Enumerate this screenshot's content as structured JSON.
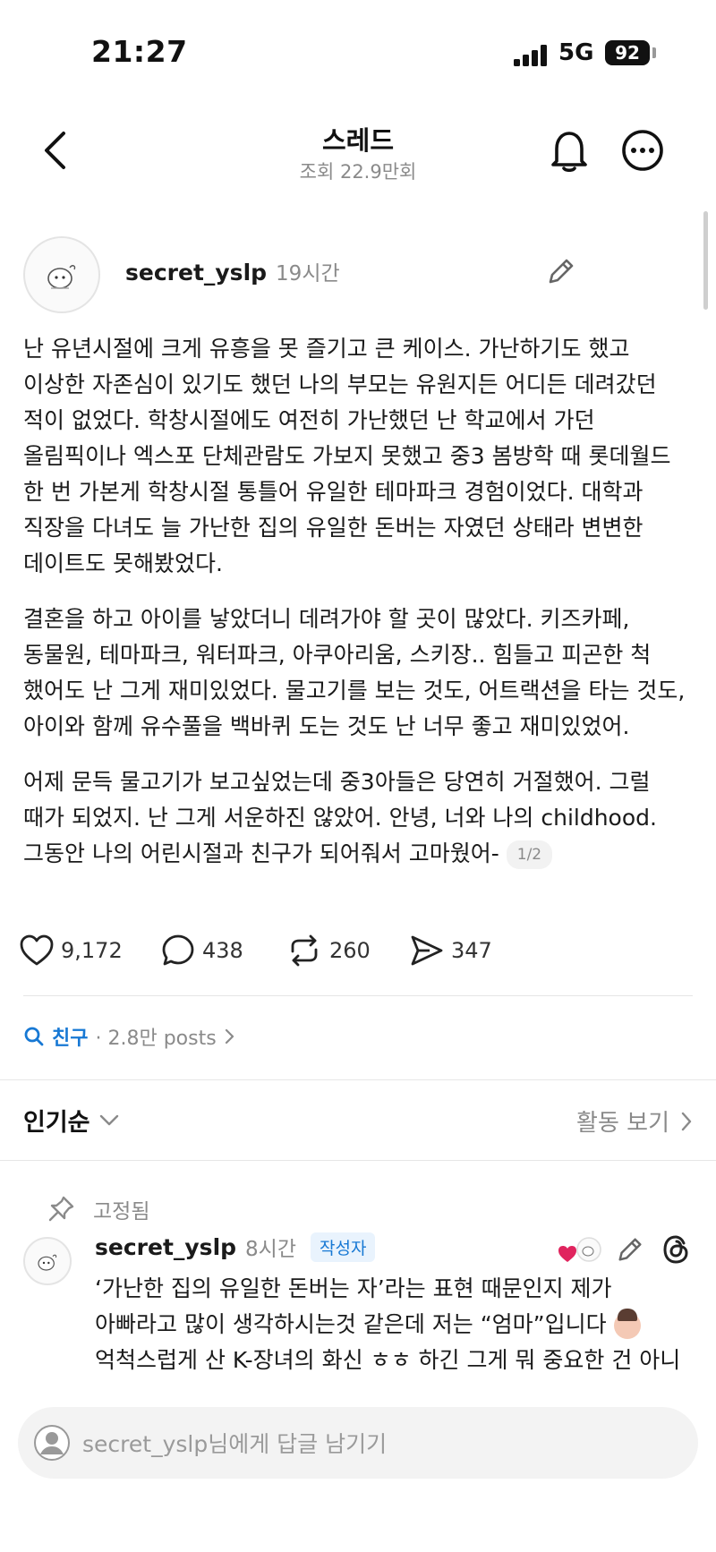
{
  "status_bar": {
    "time": "21:27",
    "network": "5G",
    "battery": "92"
  },
  "header": {
    "title": "스레드",
    "subtitle": "조회 22.9만회"
  },
  "post": {
    "author": "secret_yslp",
    "time": "19시간",
    "paragraphs": [
      "난 유년시절에 크게 유흥을 못 즐기고 큰 케이스. 가난하기도 했고 이상한 자존심이 있기도 했던 나의 부모는 유원지든 어디든 데려갔던 적이 없었다. 학창시절에도 여전히 가난했던 난 학교에서 가던 올림픽이나 엑스포 단체관람도 가보지 못했고 중3 봄방학 때 롯데월드 한 번 가본게 학창시절 통틀어 유일한 테마파크 경험이었다. 대학과 직장을 다녀도 늘 가난한 집의 유일한 돈버는 자였던 상태라 변변한 데이트도 못해봤었다.",
      "결혼을 하고 아이를 낳았더니 데려가야 할 곳이 많았다. 키즈카페, 동물원, 테마파크, 워터파크, 아쿠아리움, 스키장.. 힘들고 피곤한 척 했어도 난 그게 재미있었다. 물고기를 보는 것도, 어트랙션을 타는 것도, 아이와 함께 유수풀을 백바퀴 도는 것도 난 너무 좋고 재미있었어.",
      "어제 문득 물고기가 보고싶었는데 중3아들은 당연히 거절했어. 그럴 때가 되었지. 난 그게 서운하진 않았어. 안녕, 너와 나의 childhood. 그동안 나의 어린시절과 친구가 되어줘서 고마웠어-"
    ],
    "page_indicator": "1/2",
    "likes": "9,172",
    "comments": "438",
    "reposts": "260",
    "shares": "347"
  },
  "topic": {
    "name": "친구",
    "meta": "· 2.8만 posts"
  },
  "sort": {
    "label": "인기순",
    "activity": "활동 보기"
  },
  "comment": {
    "pinned_label": "고정됨",
    "author": "secret_yslp",
    "time": "8시간",
    "badge": "작성자",
    "text_part1": "‘가난한 집의 유일한 돈버는 자’라는 표현 때문인지 제가 아빠라고 많이 생각하시는것 같은데 저는 “엄마”입니다 ",
    "text_part2": " 억척스럽게 산 K-장녀의 화신 ㅎㅎ 하긴 그게 뭐 중요한 건 아니"
  },
  "reply": {
    "placeholder": "secret_yslp님에게 답글 남기기"
  },
  "colors": {
    "accent": "#1778d4",
    "like": "#e0245e",
    "muted": "#8a8a8a"
  }
}
